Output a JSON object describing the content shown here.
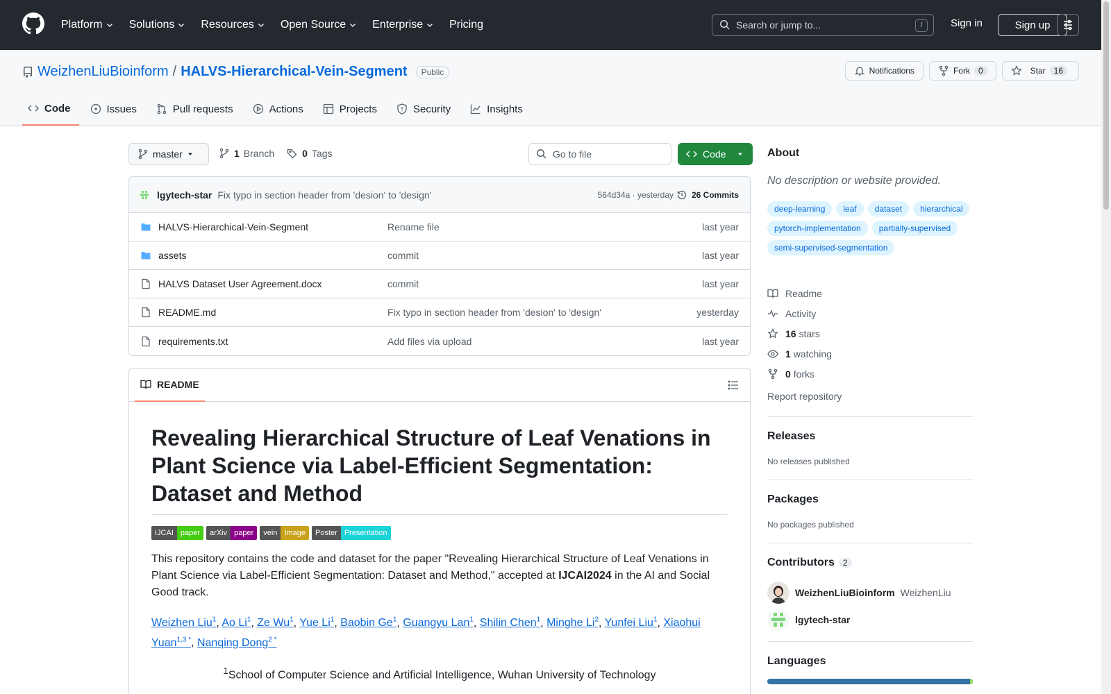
{
  "topnav": {
    "items": [
      "Platform",
      "Solutions",
      "Resources",
      "Open Source",
      "Enterprise"
    ],
    "pricing": "Pricing",
    "search_placeholder": "Search or jump to...",
    "search_kbd": "/",
    "signin": "Sign in",
    "signup": "Sign up"
  },
  "repo": {
    "owner": "WeizhenLiuBioinform",
    "name": "HALVS-Hierarchical-Vein-Segment",
    "visibility": "Public",
    "notifications": "Notifications",
    "fork_label": "Fork",
    "fork_count": "0",
    "star_label": "Star",
    "star_count": "16",
    "tabs": [
      "Code",
      "Issues",
      "Pull requests",
      "Actions",
      "Projects",
      "Security",
      "Insights"
    ]
  },
  "filebar": {
    "branch": "master",
    "branch_count": "1",
    "branch_label": "Branch",
    "tag_count": "0",
    "tag_label": "Tags",
    "goto_placeholder": "Go to file",
    "code_button": "Code"
  },
  "commit": {
    "author": "lgytech-star",
    "message": "Fix typo in section header from 'desion' to 'design'",
    "hash_time": "564d34a · yesterday",
    "commits": "26 Commits"
  },
  "files": [
    {
      "name": "HALVS-Hierarchical-Vein-Segment",
      "type": "dir",
      "message": "Rename file",
      "time": "last year"
    },
    {
      "name": "assets",
      "type": "dir",
      "message": "commit",
      "time": "last year"
    },
    {
      "name": "HALVS Dataset User Agreement.docx",
      "type": "file",
      "message": "commit",
      "time": "last year"
    },
    {
      "name": "README.md",
      "type": "file",
      "message": "Fix typo in section header from 'desion' to 'design'",
      "time": "yesterday"
    },
    {
      "name": "requirements.txt",
      "type": "file",
      "message": "Add files via upload",
      "time": "last year"
    }
  ],
  "readme": {
    "tab": "README",
    "title": "Revealing Hierarchical Structure of Leaf Venations in Plant Science via Label-Efficient Segmentation: Dataset and Method",
    "badges": [
      {
        "left": "IJCAI",
        "right": "paper",
        "color": "#4c1"
      },
      {
        "left": "arXiv",
        "right": "paper",
        "color": "#8a008a"
      },
      {
        "left": "vein",
        "right": "Image",
        "color": "#c9a21a"
      },
      {
        "left": "Poster",
        "right": "Presentation",
        "color": "#1cd3d8"
      }
    ],
    "intro_before": "This repository contains the code and dataset for the paper \"Revealing Hierarchical Structure of Leaf Venations in Plant Science via Label-Efficient Segmentation: Dataset and Method,\" accepted at ",
    "intro_bold": "IJCAI2024",
    "intro_after": " in the AI and Social Good track.",
    "authors": [
      {
        "name": "Weizhen Liu",
        "sup": "1"
      },
      {
        "name": "Ao Li",
        "sup": "1"
      },
      {
        "name": "Ze Wu",
        "sup": "1"
      },
      {
        "name": "Yue Li",
        "sup": "1"
      },
      {
        "name": "Baobin Ge",
        "sup": "1"
      },
      {
        "name": "Guangyu Lan",
        "sup": "1"
      },
      {
        "name": "Shilin Chen",
        "sup": "1"
      },
      {
        "name": "Minghe Li",
        "sup": "2"
      },
      {
        "name": "Yunfei Liu",
        "sup": "1"
      },
      {
        "name": "Xiaohui Yuan",
        "sup": "1,3 *"
      },
      {
        "name": "Nanqing Dong",
        "sup": "2 *"
      }
    ],
    "affil_sup": "1",
    "affil": "School of Computer Science and Artificial Intelligence, Wuhan University of Technology"
  },
  "about": {
    "title": "About",
    "desc": "No description or website provided.",
    "topics": [
      "deep-learning",
      "leaf",
      "dataset",
      "hierarchical",
      "pytorch-implementation",
      "partially-supervised",
      "semi-supervised-segmentation"
    ],
    "readme": "Readme",
    "activity": "Activity",
    "stars_n": "16",
    "stars": "stars",
    "watching_n": "1",
    "watching": "watching",
    "forks_n": "0",
    "forks": "forks",
    "report": "Report repository"
  },
  "releases": {
    "title": "Releases",
    "sub": "No releases published"
  },
  "packages": {
    "title": "Packages",
    "sub": "No packages published"
  },
  "contributors": {
    "title": "Contributors",
    "count": "2",
    "list": [
      {
        "login": "WeizhenLiuBioinform",
        "name": "WeizhenLiu"
      },
      {
        "login": "lgytech-star",
        "name": ""
      }
    ]
  },
  "languages": {
    "title": "Languages"
  }
}
